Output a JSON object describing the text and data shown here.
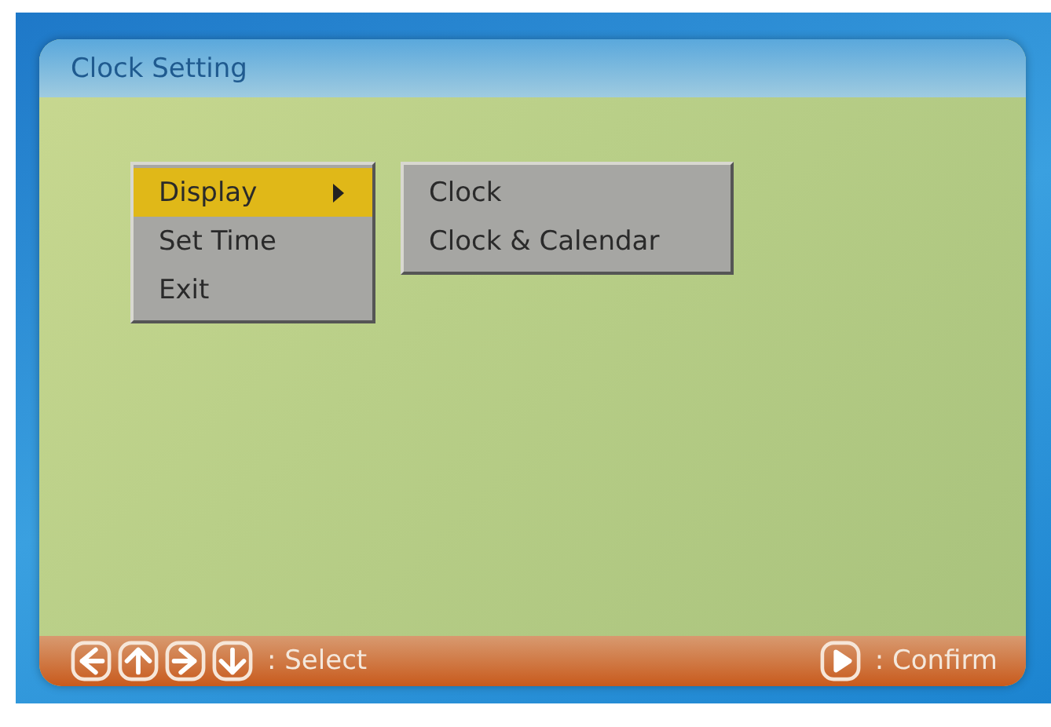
{
  "window": {
    "title": "Clock Setting"
  },
  "menu": {
    "items": [
      {
        "label": "Display",
        "selected": true,
        "submenu": true
      },
      {
        "label": "Set Time",
        "selected": false,
        "submenu": false
      },
      {
        "label": "Exit",
        "selected": false,
        "submenu": false
      }
    ]
  },
  "submenu": {
    "items": [
      {
        "label": "Clock",
        "selected": false
      },
      {
        "label": "Clock & Calendar",
        "selected": false
      }
    ]
  },
  "footer": {
    "left": {
      "keys": [
        {
          "kind": "left"
        },
        {
          "kind": "up"
        },
        {
          "kind": "right"
        },
        {
          "kind": "down"
        }
      ],
      "label": ": Select"
    },
    "right": {
      "keys": [
        {
          "kind": "play"
        }
      ],
      "label": ": Confirm"
    }
  }
}
